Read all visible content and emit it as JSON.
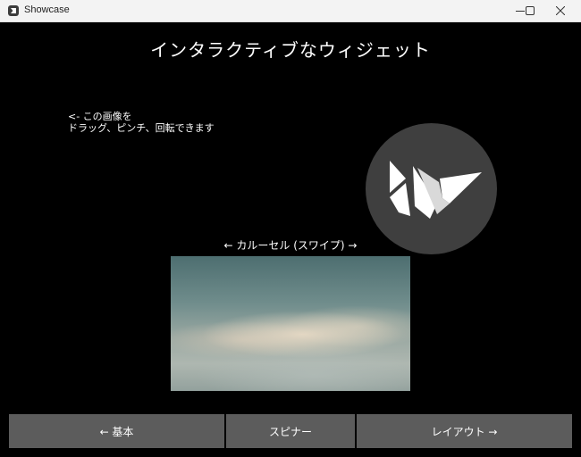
{
  "window": {
    "title": "Showcase",
    "controls": {
      "minimize_icon": "minimize-icon",
      "maximize_icon": "maximize-icon",
      "close_icon": "close-icon"
    }
  },
  "screen": {
    "heading": "インタラクティブなウィジェット",
    "hint_line1": "<- この画像を",
    "hint_line2": "ドラッグ、ピンチ、回転できます",
    "logo_icon": "kivy-logo-icon",
    "carousel_label": "← カルーセル (スワイプ) →"
  },
  "nav": {
    "back_label": "← 基本",
    "spinner_label": "スピナー",
    "next_label": "レイアウト →"
  },
  "colors": {
    "background": "#000000",
    "button": "#5c5c5c",
    "logo_circle": "#3f3f3f",
    "text": "#ffffff"
  }
}
